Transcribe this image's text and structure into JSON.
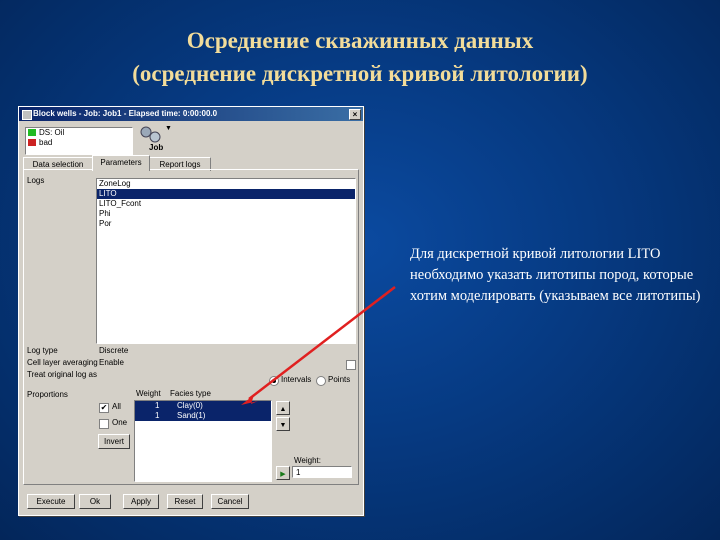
{
  "slide": {
    "title_line1": "Осреднение скважинных данных",
    "title_line2": "(осреднение дискретной кривой литологии)",
    "note": "Для дискретной кривой литологии LITO необходимо указать литотипы пород, которые хотим моделировать (указываем все литотипы)"
  },
  "window": {
    "title": "Block wells - Job: Job1 - Elapsed time: 0:00:00.0",
    "close_glyph": "×",
    "inputs": [
      {
        "label": "DS: Oil",
        "color": "#22bb22"
      },
      {
        "label": "bad",
        "color": "#cc2222"
      }
    ],
    "job_label": "Job",
    "tabs": [
      "Data selection",
      "Parameters",
      "Report logs"
    ],
    "logs_label": "Logs",
    "logs": [
      "ZoneLog",
      "LITO",
      "LITO_Fcont",
      "Phi",
      "Por"
    ],
    "logs_selected_index": 1,
    "log_type_label": "Log type",
    "log_type_value": "Discrete",
    "cell_layer_label": "Cell layer averaging",
    "cell_layer_value": "Enable",
    "treat_label": "Treat original log as",
    "radio_intervals": "Intervals",
    "radio_points": "Points",
    "proportions_label": "Proportions",
    "weight_header": "Weight",
    "facies_header": "Facies type",
    "facies_rows": [
      {
        "weight": "1",
        "name": "Clay(0)"
      },
      {
        "weight": "1",
        "name": "Sand(1)"
      }
    ],
    "all_label": "All",
    "one_label": "One",
    "invert_label": "Invert",
    "weight_label": "Weight:",
    "weight_value": "1",
    "buttons": [
      "Execute",
      "Ok",
      "Apply",
      "Reset",
      "Cancel"
    ],
    "checkmark": "✔"
  },
  "colors": {
    "title": "#f2dc9a",
    "arrow": "#e02020",
    "selection": "#0a246a"
  }
}
